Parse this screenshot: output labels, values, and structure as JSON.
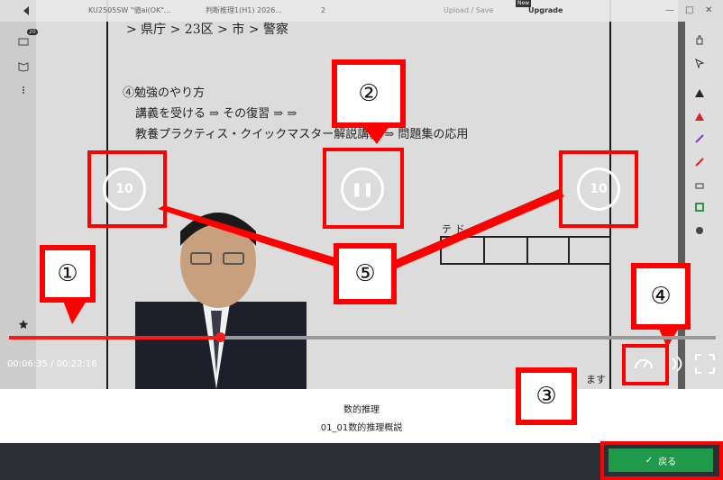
{
  "topbar": {
    "tab1": "KU2505SW \"値ai(OK\"...",
    "tab2": "判断推理1(H1) 2026...",
    "zoom": "2",
    "upload": "Upload / Save",
    "upgrade": "Upgrade",
    "new_badge": "New"
  },
  "leftbar": {
    "badge": "20"
  },
  "board": {
    "line_top": "> 県庁 > 23区 > 市 > 警察",
    "heading": "④勉強のやり方",
    "line2": "講義を受ける ⇒ その復習 ⇒ ⇒",
    "line3": "教養プラクティス・クイックマスター解説講義 ⇒ 問題集の応用",
    "table_label": "テ ド",
    "bottom_text": "ます"
  },
  "controls": {
    "rewind_label": "10",
    "forward_label": "10",
    "pause_glyph": "❚❚"
  },
  "progress": {
    "fraction": 0.298,
    "time": "00:06:35 / 00:22:16"
  },
  "annotations": [
    "①",
    "②",
    "③",
    "④",
    "⑤"
  ],
  "info": {
    "title": "数的推理",
    "subtitle": "01_01数的推理概説"
  },
  "back_button": {
    "label": "戻る",
    "check": "✓"
  }
}
